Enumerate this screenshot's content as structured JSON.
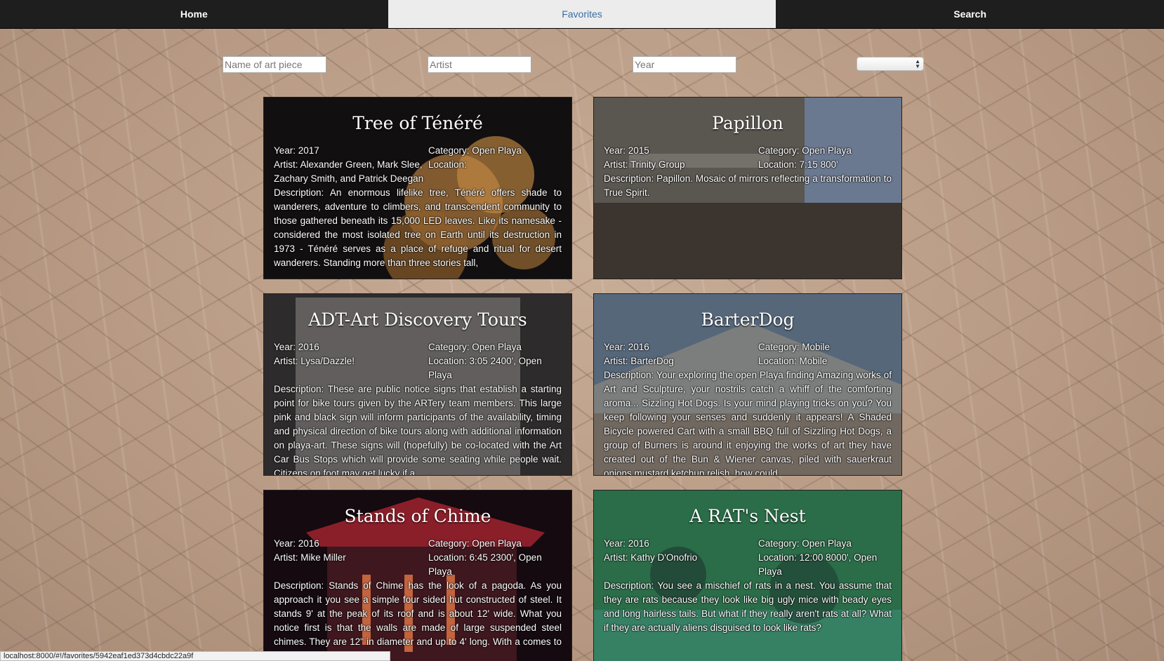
{
  "nav": {
    "home": "Home",
    "favorites": "Favorites",
    "search": "Search"
  },
  "filters": {
    "name_placeholder": "Name of art piece",
    "artist_placeholder": "Artist",
    "year_placeholder": "Year",
    "select_value": ""
  },
  "cards": [
    {
      "title": "Tree of Ténéré",
      "year": "Year: 2017",
      "category": "Category: Open Playa",
      "artist": "Artist: Alexander Green, Mark Slee, Zachary Smith, and Patrick Deegan",
      "location": "Location:",
      "description": "Description: An enormous lifelike tree, Ténéré offers shade to wanderers, adventure to climbers, and transcendent community to those gathered beneath its 15,000 LED leaves.  Like its namesake - considered the most isolated tree on Earth until its destruction in 1973 - Ténéré serves as a place of refuge and ritual for desert wanderers. Standing more than three stories tall,",
      "bg": "#1a1412"
    },
    {
      "title": "Papillon",
      "year": "Year: 2015",
      "category": "Category: Open Playa",
      "artist": "Artist: Trinity Group",
      "location": "Location: 7:15 800'",
      "description": "Description: Papillon. Mosaic of mirrors reflecting a transformation to True Spirit.",
      "bg": "#4b4a45"
    },
    {
      "title": "ADT-Art Discovery Tours",
      "year": "Year: 2016",
      "category": "Category: Open Playa",
      "artist": "Artist: Lysa/Dazzle!",
      "location": "Location: 3:05 2400', Open Playa",
      "description": "Description: These are public notice signs that establish a starting point for bike tours given by the ARTery team members. This large pink and black sign will inform participants of the availability, timing and physical direction of bike tours along with additional information on playa-art. These signs will (hopefully) be co-located with the Art Car Bus Stops which will provide some seating while people wait. Citizens on foot may get lucky if a",
      "bg": "#3d3a3a"
    },
    {
      "title": "BarterDog",
      "year": "Year: 2016",
      "category": "Category: Mobile",
      "artist": "Artist: BarterDog",
      "location": "Location: Mobile",
      "description": "Description: Your exploring the open Playa finding Amazing works of Art and Sculpture, your nostrils catch a whiff of the comforting aroma... Sizzling Hot Dogs. Is your mind playing tricks on you? You keep following your senses and suddenly it appears! A Shaded Bicycle powered Cart with a small BBQ full of Sizzling Hot Dogs, a group of Burners is around it enjoying the works of art they have created out of the Bun & Wiener canvas, piled with sauerkraut onions mustard ketchup relish, how could",
      "bg": "#4a5a66"
    },
    {
      "title": "Stands of Chime",
      "year": "Year: 2016",
      "category": "Category: Open Playa",
      "artist": "Artist: Mike Miller",
      "location": "Location: 6:45 2300', Open Playa",
      "description": "Description: Stands of Chime has the look of a pagoda. As you approach it you see a simple four sided hut constructed of steel. It stands 9' at the peak of its roof and is about 12' wide. What you notice first is that the walls are made of large suspended steel chimes. They are 12\" in diameter and up to 4' long. With a comes to life as an enormous wind",
      "bg": "#1b0e14"
    },
    {
      "title": "A RAT's Nest",
      "year": "Year: 2016",
      "category": "Category: Open Playa",
      "artist": "Artist: Kathy D'Onofrio",
      "location": "Location: 12:00 8000', Open Playa",
      "description": "Description: You see a mischief of rats in a nest. You assume that they are rats because they look like big ugly mice with beady eyes and long hairless tails. But what if they really aren't rats at all? What if they are actually aliens disguised to look like rats?",
      "bg": "#2c6a45"
    }
  ],
  "status": {
    "url": "localhost:8000/#!/favorites/5942eaf1ed373d4cbdc22a9f"
  }
}
